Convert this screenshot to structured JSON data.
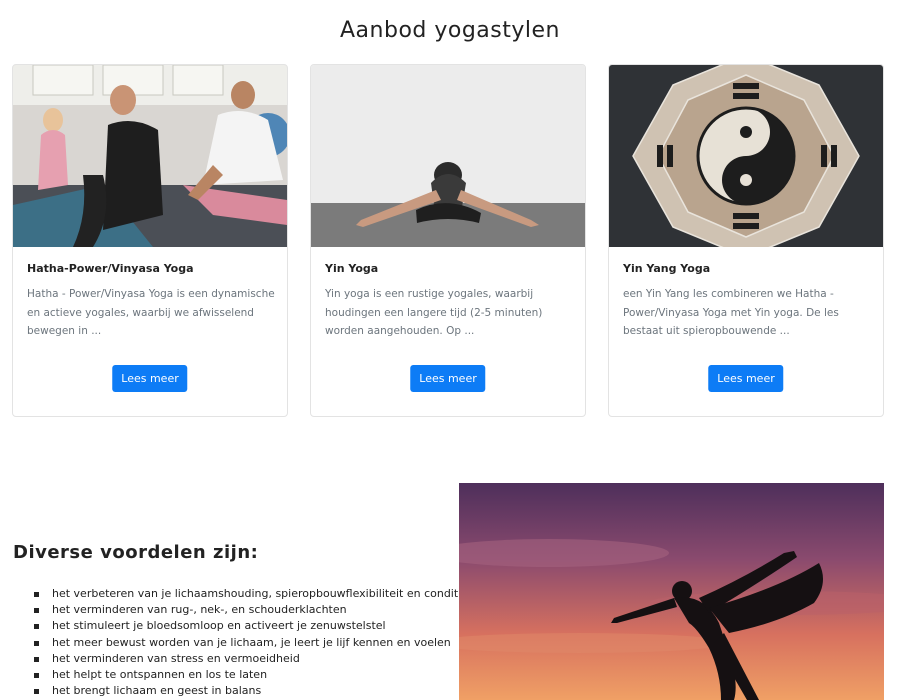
{
  "section_title": "Aanbod yogastylen",
  "cards": [
    {
      "title": "Hatha-Power/Vinyasa Yoga",
      "text": "Hatha - Power/Vinyasa Yoga is een dynamische en actieve yogales, waarbij we afwisselend bewegen in ...",
      "button": "Lees meer",
      "image": "gym-class-cobra-pose-photo"
    },
    {
      "title": "Yin Yoga",
      "text": "Yin yoga is een rustige yogales, waarbij houdingen een langere tijd (2-5 minuten) worden aangehouden. Op ...",
      "button": "Lees meer",
      "image": "woman-forward-fold-photo"
    },
    {
      "title": "Yin Yang Yoga",
      "text": "een Yin Yang les combineren we Hatha - Power/Vinyasa Yoga met Yin yoga. De les bestaat uit spieropbouwende ...",
      "button": "Lees meer",
      "image": "yin-yang-mosaic-photo"
    }
  ],
  "benefits": {
    "title": "Diverse voordelen zijn:",
    "items": [
      "het verbeteren van je lichaamshouding, spieropbouwflexibiliteit en conditie",
      "het verminderen van rug-, nek-, en schouderklachten",
      "het stimuleert je bloedsomloop en activeert je zenuwstelstel",
      "het meer bewust worden van je lichaam, je leert je lijf kennen en voelen",
      "het verminderen van stress en vermoeidheid",
      "het helpt te ontspannen en los te laten",
      "het brengt lichaam en geest in balans"
    ],
    "image": "sunset-dancer-pose-silhouette-photo"
  },
  "colors": {
    "button": "#0d7cf6",
    "muted_text": "#6c757d"
  }
}
